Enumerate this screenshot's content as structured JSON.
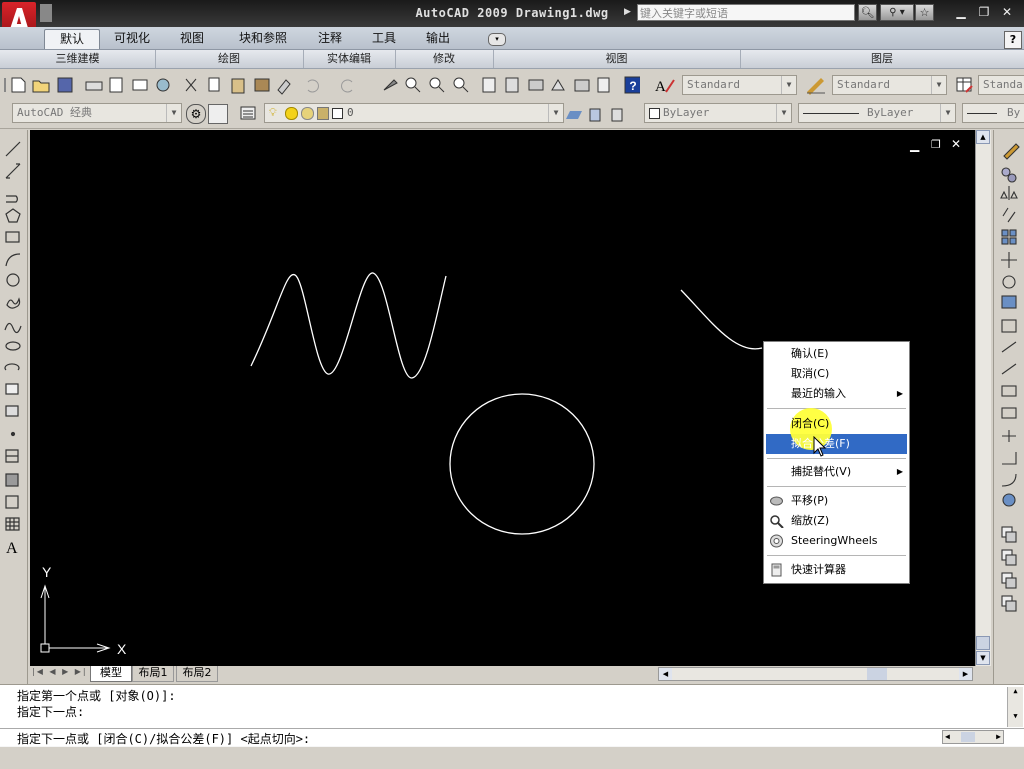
{
  "app": {
    "title": "AutoCAD 2009 Drawing1.dwg",
    "search_placeholder": "键入关键字或短语"
  },
  "ribbon": {
    "tabs": [
      "默认",
      "可视化",
      "视图",
      "块和参照",
      "注释",
      "工具",
      "输出"
    ],
    "panels": [
      "三维建模",
      "绘图",
      "实体编辑",
      "修改",
      "视图",
      "图层"
    ]
  },
  "toolbar1": {
    "text_style": "Standard",
    "dim_style": "Standard",
    "table_style": "Standar"
  },
  "toolbar2": {
    "workspace": "AutoCAD 经典",
    "layer_name": "0",
    "color": "ByLayer",
    "linetype": "ByLayer",
    "lineweight": "By"
  },
  "ucs": {
    "x_label": "X",
    "y_label": "Y"
  },
  "layout_tabs": [
    "模型",
    "布局1",
    "布局2"
  ],
  "context_menu": {
    "items": [
      {
        "label": "确认(E)",
        "icon": null,
        "submenu": false
      },
      {
        "label": "取消(C)",
        "icon": null,
        "submenu": false
      },
      {
        "label": "最近的输入",
        "icon": null,
        "submenu": true
      },
      {
        "label": "闭合(C)",
        "icon": null,
        "submenu": false
      },
      {
        "label": "拟合公差(F)",
        "icon": null,
        "submenu": false,
        "highlighted": true
      },
      {
        "label": "捕捉替代(V)",
        "icon": null,
        "submenu": true
      },
      {
        "label": "平移(P)",
        "icon": "pan-icon",
        "submenu": false
      },
      {
        "label": "缩放(Z)",
        "icon": "zoom-icon",
        "submenu": false
      },
      {
        "label": "SteeringWheels",
        "icon": "steering-wheel-icon",
        "submenu": false
      },
      {
        "label": "快速计算器",
        "icon": "calculator-icon",
        "submenu": false
      }
    ],
    "highlight_color": "#316ac5"
  },
  "command": {
    "history": [
      "指定第一个点或 [对象(O)]:",
      "指定下一点:"
    ],
    "prompt": "指定下一点或 [闭合(C)/拟合公差(F)] <起点切向>:"
  },
  "colors": {
    "accent_red": "#c8161d",
    "canvas": "#000000",
    "pointer_highlight": "#ffff3a"
  }
}
